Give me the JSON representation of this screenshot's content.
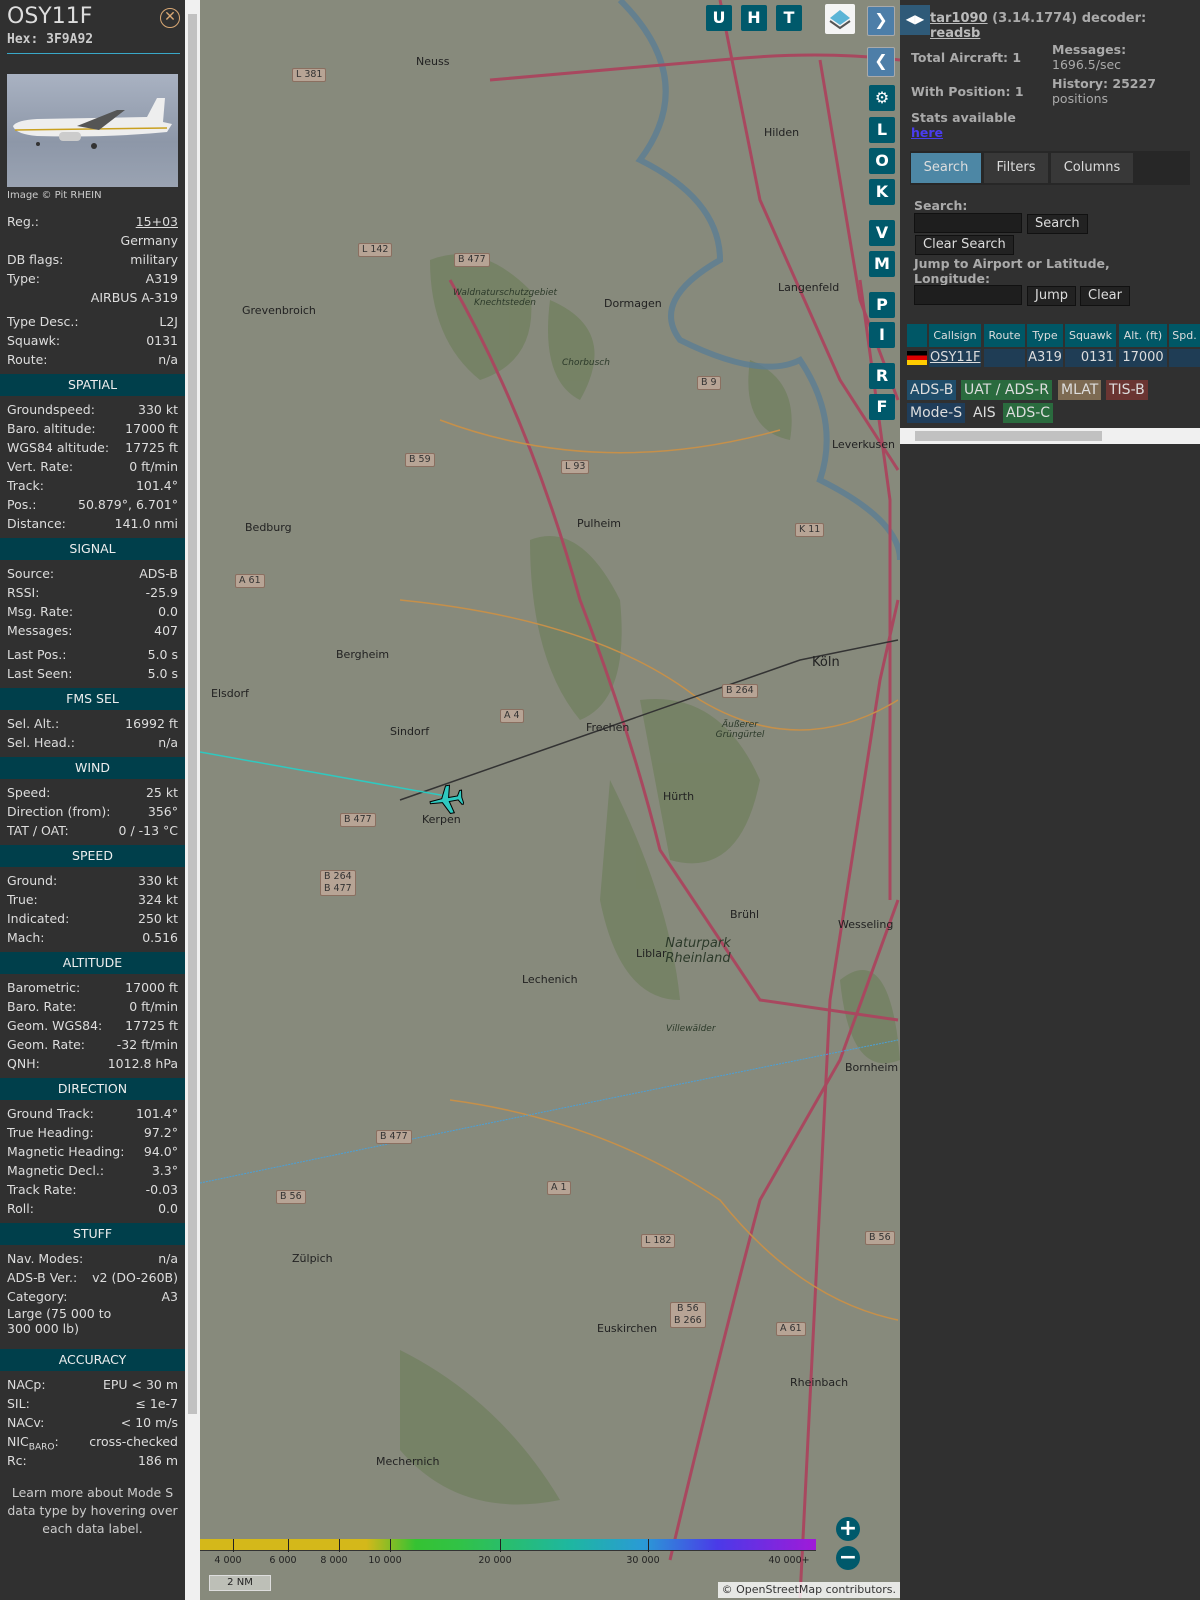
{
  "sidebar": {
    "callsign": "OSY11F",
    "hex": "Hex: 3F9A92",
    "close_icon": "close-circle-icon",
    "image_credit": "Image © Pit RHEIN",
    "sections": [
      {
        "title": "",
        "rows": [
          [
            "Reg.:",
            "15+03"
          ],
          [
            "",
            "Germany"
          ],
          [
            "DB flags:",
            "military"
          ],
          [
            "Type:",
            "A319"
          ],
          [
            "",
            "AIRBUS A-319"
          ],
          [
            "Type Desc.:",
            "L2J"
          ],
          [
            "Squawk:",
            "0131"
          ],
          [
            "Route:",
            "n/a"
          ]
        ]
      },
      {
        "title": "SPATIAL",
        "rows": [
          [
            "Groundspeed:",
            "330 kt"
          ],
          [
            "Baro. altitude:",
            "17000 ft"
          ],
          [
            "WGS84 altitude:",
            "17725 ft"
          ],
          [
            "Vert. Rate:",
            "0 ft/min"
          ],
          [
            "Track:",
            "101.4°"
          ],
          [
            "Pos.:",
            "50.879°, 6.701°"
          ],
          [
            "Distance:",
            "141.0 nmi"
          ]
        ]
      },
      {
        "title": "SIGNAL",
        "rows": [
          [
            "Source:",
            "ADS-B"
          ],
          [
            "RSSI:",
            "-25.9"
          ],
          [
            "Msg. Rate:",
            "0.0"
          ],
          [
            "Messages:",
            "407"
          ],
          [
            "Last Pos.:",
            "5.0 s"
          ],
          [
            "Last Seen:",
            "5.0 s"
          ]
        ]
      },
      {
        "title": "FMS SEL",
        "rows": [
          [
            "Sel. Alt.:",
            "16992 ft"
          ],
          [
            "Sel. Head.:",
            "n/a"
          ]
        ]
      },
      {
        "title": "WIND",
        "rows": [
          [
            "Speed:",
            "25 kt"
          ],
          [
            "Direction (from):",
            "356°"
          ],
          [
            "TAT / OAT:",
            "0 / -13 °C"
          ]
        ]
      },
      {
        "title": "SPEED",
        "rows": [
          [
            "Ground:",
            "330 kt"
          ],
          [
            "True:",
            "324 kt"
          ],
          [
            "Indicated:",
            "250 kt"
          ],
          [
            "Mach:",
            "0.516"
          ]
        ]
      },
      {
        "title": "ALTITUDE",
        "rows": [
          [
            "Barometric:",
            "17000 ft"
          ],
          [
            "Baro. Rate:",
            "0 ft/min"
          ],
          [
            "Geom. WGS84:",
            "17725 ft"
          ],
          [
            "Geom. Rate:",
            "-32 ft/min"
          ],
          [
            "QNH:",
            "1012.8 hPa"
          ]
        ]
      },
      {
        "title": "DIRECTION",
        "rows": [
          [
            "Ground Track:",
            "101.4°"
          ],
          [
            "True Heading:",
            "97.2°"
          ],
          [
            "Magnetic Heading:",
            "94.0°"
          ],
          [
            "Magnetic Decl.:",
            "3.3°"
          ],
          [
            "Track Rate:",
            "-0.03"
          ],
          [
            "Roll:",
            "0.0"
          ]
        ]
      },
      {
        "title": "STUFF",
        "rows": [
          [
            "Nav. Modes:",
            "n/a"
          ],
          [
            "ADS-B Ver.:",
            "v2 (DO-260B)"
          ],
          [
            "Category:",
            "A3"
          ],
          [
            "Large (75 000 to 300 000 lb)",
            ""
          ]
        ]
      },
      {
        "title": "ACCURACY",
        "rows": [
          [
            "NACp:",
            "EPU < 30 m"
          ],
          [
            "SIL:",
            "≤ 1e-7"
          ],
          [
            "NACv:",
            "< 10 m/s"
          ],
          [
            "NICbaro:",
            "cross-checked"
          ],
          [
            "Rc:",
            "186 m"
          ]
        ]
      }
    ],
    "footer": "Learn more about Mode S data type by hovering over each data label."
  },
  "map": {
    "buttons": [
      "U",
      "H",
      "T"
    ],
    "side_buttons": [
      "L",
      "O",
      "K",
      "V",
      "M",
      "P",
      "I",
      "R",
      "F"
    ],
    "places": [
      "Neuss",
      "Hilden",
      "Grevenbroich",
      "Dormagen",
      "Langenfeld",
      "Leverkusen",
      "Pulheim",
      "Bedburg",
      "Bergheim",
      "Köln",
      "Elsdorf",
      "Sindorf",
      "Frechen",
      "Kerpen",
      "Hürth",
      "Brühl",
      "Wesseling",
      "Liblar",
      "Lechenich",
      "Naturpark Rheinland",
      "Bornheim",
      "Zülpich",
      "Euskirchen",
      "Rheinbach",
      "Mechernich",
      "Chorbusch",
      "Waldnaturschutzgebiet Knechtsteden",
      "Äußerer Grüngürtel",
      "Villewälder"
    ],
    "shields": [
      "L 381",
      "L 142",
      "B 477",
      "B 59",
      "L 93",
      "B 9",
      "K 11",
      "A 61",
      "A 4",
      "B 264",
      "B 477",
      "B 264\nB 477",
      "B 477",
      "B 56",
      "A 1",
      "L 182",
      "B 56\nB 266",
      "A 61",
      "B 56"
    ],
    "legend_ticks": [
      "4 000",
      "6 000",
      "8 000",
      "10 000",
      "20 000",
      "30 000",
      "40 000+"
    ],
    "scale": "2 NM",
    "attribution": "© OpenStreetMap contributors.",
    "zoom_in": "+",
    "zoom_out": "−"
  },
  "panel": {
    "title_link": "tar1090",
    "version": "(3.14.1774) decoder:",
    "decoder": "readsb",
    "total_aircraft": "Total Aircraft: 1",
    "with_position": "With Position: 1",
    "messages_label": "Messages:",
    "messages_value": "1696.5/sec",
    "history_label": "History: 25227",
    "history_value": "positions",
    "stats": "Stats available",
    "stats_link": "here",
    "tabs": [
      "Search",
      "Filters",
      "Columns"
    ],
    "search_label": "Search:",
    "search_btn": "Search",
    "clear_search": "Clear Search",
    "jump_label": "Jump to Airport or Latitude, Longitude:",
    "jump_btn": "Jump",
    "clear_btn": "Clear",
    "columns": [
      "",
      "Callsign",
      "Route",
      "Type",
      "Squawk",
      "Alt. (ft)",
      "Spd."
    ],
    "row": {
      "callsign": "OSY11F",
      "route": "",
      "type": "A319",
      "squawk": "0131",
      "alt": "17000",
      "spd": ""
    },
    "sources": [
      "ADS-B",
      "UAT / ADS-R",
      "MLAT",
      "TIS-B",
      "Mode-S",
      "AIS",
      "ADS-C"
    ]
  },
  "colors": {
    "accent": "#003f4b",
    "button": "#00596b",
    "track": "#2fc9c0",
    "aircraft": "#2fc9c0"
  }
}
